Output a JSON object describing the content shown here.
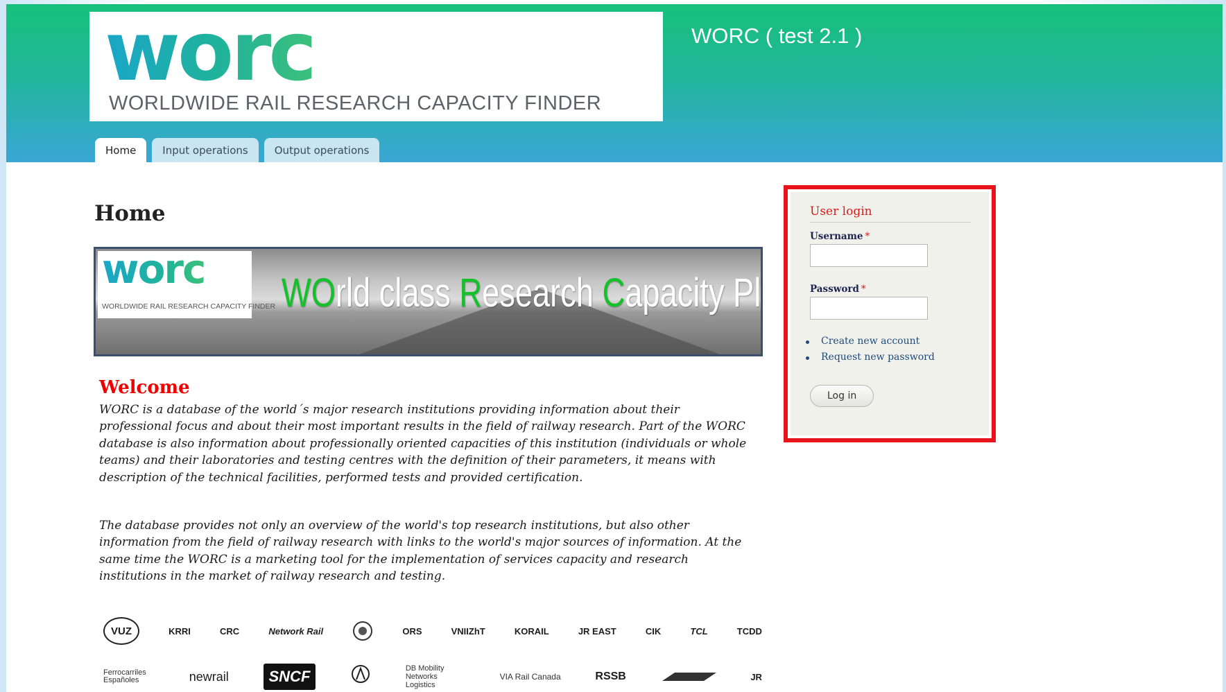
{
  "header": {
    "logo_word": "worc",
    "logo_tagline": "WORLDWIDE RAIL RESEARCH CAPACITY FINDER",
    "site_title": "WORC ( test 2.1 )"
  },
  "tabs": [
    {
      "label": "Home",
      "active": true
    },
    {
      "label": "Input operations",
      "active": false
    },
    {
      "label": "Output operations",
      "active": false
    }
  ],
  "main": {
    "heading": "Home",
    "banner": {
      "logo_word": "worc",
      "logo_tagline": "WORLDWIDE RAIL RESEARCH CAPACITY FINDER",
      "parts": [
        "W",
        "O",
        "rld class ",
        "R",
        "esearch ",
        "C",
        "apacity Plan"
      ]
    },
    "welcome_title": "Welcome",
    "paragraphs": [
      "WORC is a database of the world´s major research institutions providing information about their professional focus and about their most important results in the field of railway research. Part of the WORC database is also information about professionally oriented capacities of this institution (individuals or whole teams) and their laboratories and testing centres with the definition of their parameters, it means with description of the technical facilities, performed tests and provided certification.",
      "The database provides not only an overview of the world's top research institutions, but also other information from the field of railway research with links to the world's major sources of information. At the same time the WORC is a marketing tool for the implementation of services capacity and research institutions in the market of railway research and testing."
    ]
  },
  "partners": {
    "row1": [
      "VUZ",
      "KRRI",
      "CRC",
      "Network Rail",
      "seal",
      "ORS",
      "VNIIZhT",
      "KORAIL",
      "JR EAST",
      "CIK",
      "TCL",
      "TCDD"
    ],
    "row2": [
      "Ferrocarriles Españoles",
      "newrail",
      "SNCF",
      "seal-2",
      "DB Mobility Networks Logistics",
      "VIA Rail Canada",
      "RSSB",
      "rail-logo",
      "JR"
    ]
  },
  "login": {
    "title": "User login",
    "username_label": "Username",
    "password_label": "Password",
    "required_mark": "*",
    "links": [
      "Create new account",
      "Request new password"
    ],
    "button_label": "Log in"
  }
}
